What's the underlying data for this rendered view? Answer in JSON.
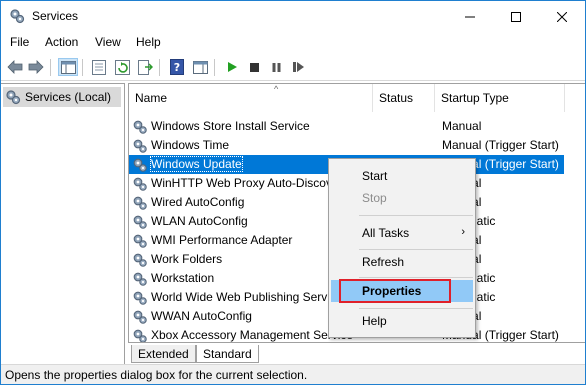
{
  "window": {
    "title": "Services"
  },
  "menubar": {
    "items": [
      "File",
      "Action",
      "View",
      "Help"
    ]
  },
  "tree": {
    "root_label": "Services (Local)"
  },
  "columns": {
    "name": "Name",
    "status": "Status",
    "startup_type": "Startup Type"
  },
  "services": [
    {
      "name": "Windows Store Install Service",
      "status": "",
      "startup": "Manual"
    },
    {
      "name": "Windows Time",
      "status": "",
      "startup": "Manual (Trigger Start)"
    },
    {
      "name": "Windows Update",
      "status": "",
      "startup": "Manual (Trigger Start)",
      "selected": true
    },
    {
      "name": "WinHTTP Web Proxy Auto-Discovery Service",
      "status": "",
      "startup": "Manual"
    },
    {
      "name": "Wired AutoConfig",
      "status": "",
      "startup": "Manual"
    },
    {
      "name": "WLAN AutoConfig",
      "status": "",
      "startup": "Automatic"
    },
    {
      "name": "WMI Performance Adapter",
      "status": "",
      "startup": "Manual"
    },
    {
      "name": "Work Folders",
      "status": "",
      "startup": "Manual"
    },
    {
      "name": "Workstation",
      "status": "",
      "startup": "Automatic"
    },
    {
      "name": "World Wide Web Publishing Service",
      "status": "",
      "startup": "Automatic"
    },
    {
      "name": "WWAN AutoConfig",
      "status": "",
      "startup": "Manual"
    },
    {
      "name": "Xbox Accessory Management Service",
      "status": "",
      "startup": "Manual (Trigger Start)"
    }
  ],
  "context_menu": {
    "start": "Start",
    "stop": "Stop",
    "all_tasks": "All Tasks",
    "refresh": "Refresh",
    "properties": "Properties",
    "help": "Help"
  },
  "tabs": {
    "extended": "Extended",
    "standard": "Standard"
  },
  "status_bar": {
    "text": "Opens the properties dialog box for the current selection."
  },
  "colors": {
    "selection": "#0078d7",
    "menu_hover": "#91c9f7",
    "highlight_box": "#e0202a",
    "window_border": "#1f7fcf"
  },
  "icons": {
    "app": "gear-icon",
    "service": "service-gear-icon"
  }
}
